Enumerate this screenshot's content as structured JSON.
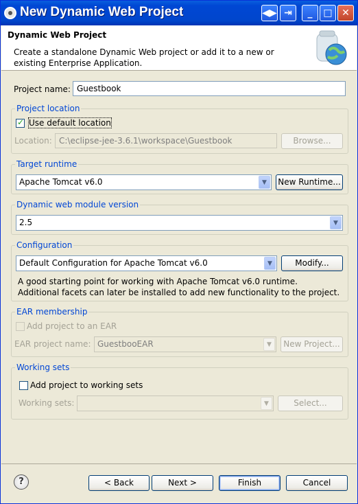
{
  "window": {
    "title": "New Dynamic Web Project"
  },
  "banner": {
    "heading": "Dynamic Web Project",
    "description": "Create a standalone Dynamic Web project or add it to a new or existing Enterprise Application."
  },
  "project_name": {
    "label": "Project name:",
    "value": "Guestbook"
  },
  "location": {
    "group_title": "Project location",
    "use_default_label": "Use default location",
    "use_default_checked": true,
    "location_label": "Location:",
    "location_value": "C:\\eclipse-jee-3.6.1\\workspace\\Guestbook",
    "browse_label": "Browse..."
  },
  "runtime": {
    "group_title": "Target runtime",
    "selected": "Apache Tomcat v6.0",
    "new_runtime_label": "New Runtime..."
  },
  "module_version": {
    "group_title": "Dynamic web module version",
    "selected": "2.5"
  },
  "configuration": {
    "group_title": "Configuration",
    "selected": "Default Configuration for Apache Tomcat v6.0",
    "modify_label": "Modify...",
    "description": "A good starting point for working with Apache Tomcat v6.0 runtime. Additional facets can later be installed to add new functionality to the project."
  },
  "ear": {
    "group_title": "EAR membership",
    "add_label": "Add project to an EAR",
    "name_label": "EAR project name:",
    "name_value": "GuestbooEAR",
    "new_project_label": "New Project..."
  },
  "working_sets": {
    "group_title": "Working sets",
    "add_label": "Add project to working sets",
    "sets_label": "Working sets:",
    "sets_value": "",
    "select_label": "Select..."
  },
  "footer": {
    "help_glyph": "?",
    "back_label": "< Back",
    "next_label": "Next >",
    "finish_label": "Finish",
    "cancel_label": "Cancel"
  },
  "colors": {
    "title_bar": "#0047d4",
    "group_title": "#0046d5",
    "dialog_bg": "#ece9d8"
  },
  "icons": [
    "app-icon",
    "switch-window-icon",
    "minimize-icon",
    "maximize-icon",
    "close-icon",
    "web-project-wizard-icon",
    "help-icon"
  ]
}
